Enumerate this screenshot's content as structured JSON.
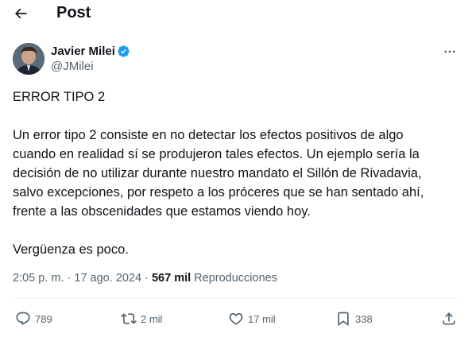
{
  "header": {
    "title": "Post",
    "back_icon": "arrow-left-icon"
  },
  "author": {
    "name": "Javier Milei",
    "handle": "@JMilei",
    "verified_icon": "verified-badge-icon",
    "verified_color": "#1d9bf0",
    "more_icon": "more-horizontal-icon"
  },
  "tweet": {
    "heading": "ERROR TIPO 2",
    "body_lines": [
      "Un error tipo 2 consiste en no detectar los efectos positivos de algo",
      "cuando en realidad sí se produjeron tales efectos. Un ejemplo sería la",
      "decisión de no utilizar durante nuestro mandato el Sillón de Rivadavia,",
      "salvo excepciones, por respeto a los próceres que se han sentado ahí,",
      "frente a las obscenidades  que estamos viendo hoy."
    ],
    "closing": "Vergüenza es poco."
  },
  "meta": {
    "time": "2:05 p. m.",
    "separator": "·",
    "date": "17 ago. 2024",
    "views_count": "567 mil",
    "views_label": "Reproducciones"
  },
  "actions": {
    "reply": {
      "icon": "reply-icon",
      "count": "789"
    },
    "retweet": {
      "icon": "retweet-icon",
      "count": "2 mil"
    },
    "like": {
      "icon": "heart-icon",
      "count": "17 mil"
    },
    "bookmark": {
      "icon": "bookmark-icon",
      "count": "338"
    },
    "share": {
      "icon": "share-icon"
    }
  },
  "colors": {
    "text": "#0f1419",
    "secondary": "#536471",
    "divider": "#eff3f4"
  }
}
